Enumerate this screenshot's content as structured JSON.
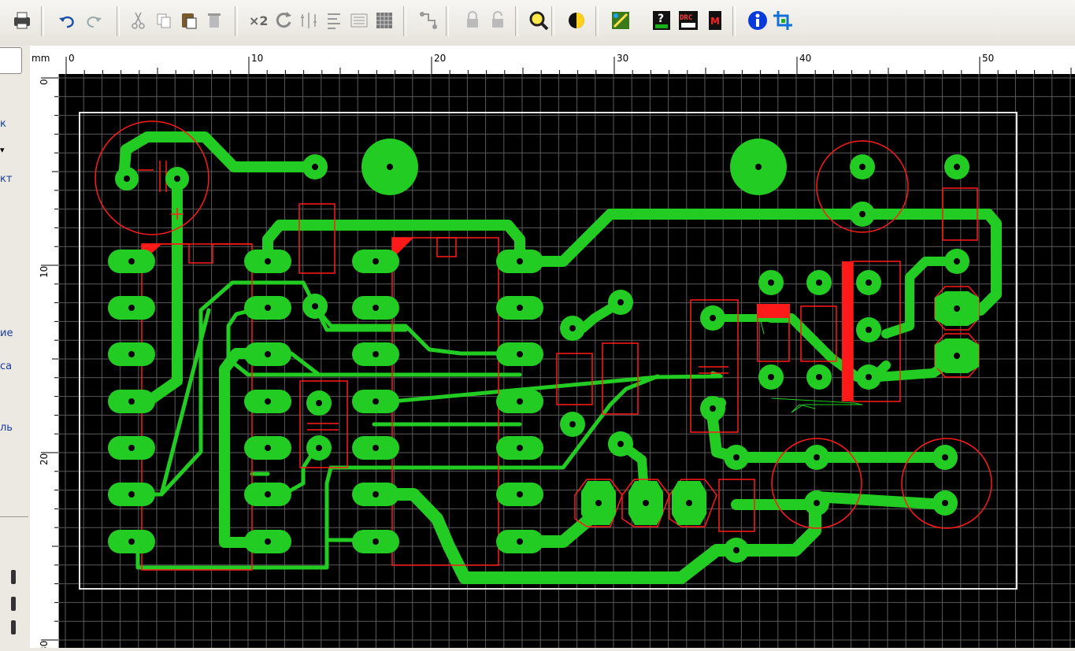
{
  "toolbar": {
    "buttons": [
      {
        "name": "print-button",
        "icon": "printer-icon"
      },
      {
        "name": "undo-button",
        "icon": "undo-icon"
      },
      {
        "name": "redo-button",
        "icon": "redo-icon"
      },
      {
        "name": "cut-button",
        "icon": "scissors-icon"
      },
      {
        "name": "copy-button",
        "icon": "copy-icon"
      },
      {
        "name": "paste-button",
        "icon": "paste-icon"
      },
      {
        "name": "delete-button",
        "icon": "trash-icon"
      },
      {
        "name": "duplicate-button",
        "icon": "x2-icon",
        "label": "×2"
      },
      {
        "name": "rotate-button",
        "icon": "rotate-icon"
      },
      {
        "name": "mirror-button",
        "icon": "mirror-icon"
      },
      {
        "name": "align-button",
        "icon": "align-icon"
      },
      {
        "name": "group-button",
        "icon": "group-icon"
      },
      {
        "name": "ungroup-button",
        "icon": "grid-icon"
      },
      {
        "name": "route-button",
        "icon": "route-icon"
      },
      {
        "name": "lock-button",
        "icon": "lock-icon"
      },
      {
        "name": "unlock-button",
        "icon": "unlock-icon"
      },
      {
        "name": "zoom-button",
        "icon": "magnifier-icon"
      },
      {
        "name": "contrast-button",
        "icon": "contrast-icon"
      },
      {
        "name": "autoroute-button",
        "icon": "autoroute-icon"
      },
      {
        "name": "test-button",
        "icon": "question-icon"
      },
      {
        "name": "drc-button",
        "icon": "drc-icon",
        "label": "DRC"
      },
      {
        "name": "macro-button",
        "icon": "macro-icon",
        "label": "M"
      },
      {
        "name": "info-button",
        "icon": "info-icon"
      },
      {
        "name": "crop-button",
        "icon": "crop-icon"
      }
    ]
  },
  "sidepanel": {
    "labels": [
      "к",
      "▾",
      "кт",
      "ие",
      "са",
      "ль"
    ]
  },
  "ruler": {
    "unit": "mm",
    "top_labels": [
      "0",
      "10",
      "20",
      "30",
      "40",
      "50"
    ],
    "left_labels": [
      "0",
      "10",
      "20",
      "30"
    ]
  },
  "colors": {
    "copper": "#22cc22",
    "silkscreen": "#ff1a1a",
    "outline": "#e6e6e6",
    "grid": "#5a5a5a",
    "background": "#000000"
  }
}
